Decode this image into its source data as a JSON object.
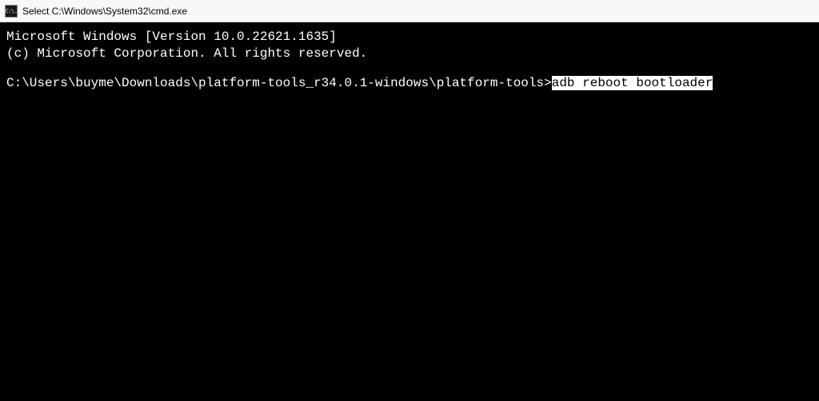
{
  "titlebar": {
    "icon_label": "C:\\.",
    "title": "Select C:\\Windows\\System32\\cmd.exe"
  },
  "terminal": {
    "line1": "Microsoft Windows [Version 10.0.22621.1635]",
    "line2": "(c) Microsoft Corporation. All rights reserved.",
    "prompt": "C:\\Users\\buyme\\Downloads\\platform-tools_r34.0.1-windows\\platform-tools>",
    "command": "adb reboot bootloader"
  }
}
